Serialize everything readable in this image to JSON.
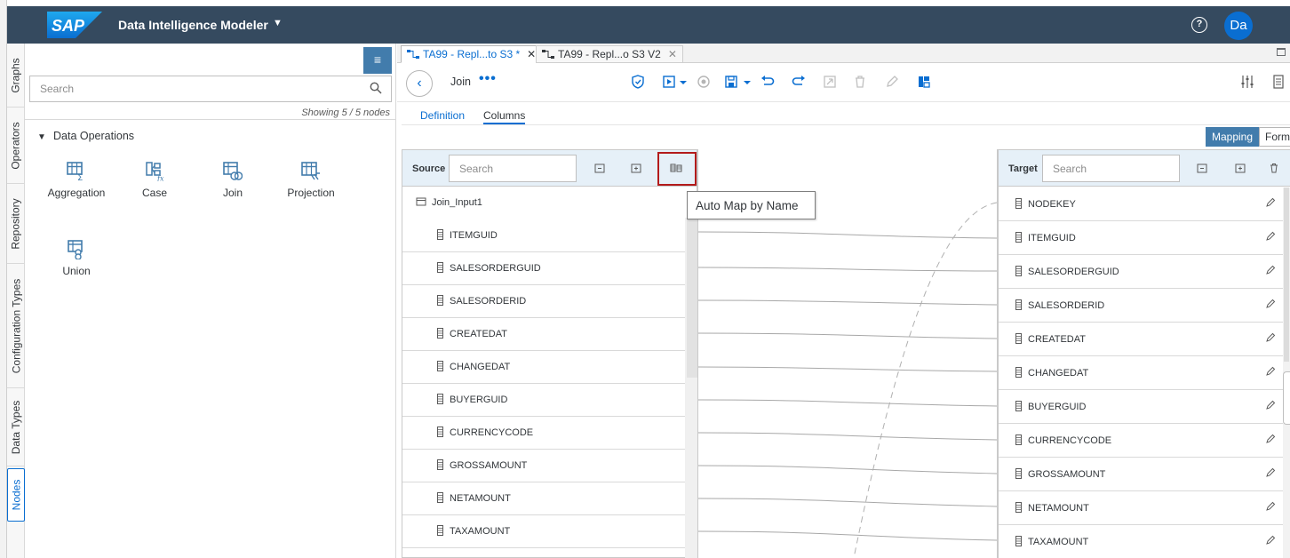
{
  "shell": {
    "logo_text": "SAP",
    "app_title": "Data Intelligence Modeler",
    "help_glyph": "?",
    "avatar_initials": "Da"
  },
  "vertical_tabs": [
    {
      "label": "Graphs"
    },
    {
      "label": "Operators"
    },
    {
      "label": "Repository"
    },
    {
      "label": "Configuration Types"
    },
    {
      "label": "Data Types"
    },
    {
      "label": "Nodes",
      "active": true
    }
  ],
  "left_panel": {
    "search_placeholder": "Search",
    "showing_text": "Showing 5 / 5 nodes",
    "group_title": "Data Operations",
    "operators": [
      {
        "label": "Aggregation",
        "icon": "aggregation-icon"
      },
      {
        "label": "Case",
        "icon": "case-icon"
      },
      {
        "label": "Join",
        "icon": "join-icon"
      },
      {
        "label": "Projection",
        "icon": "projection-icon"
      },
      {
        "label": "Union",
        "icon": "union-icon"
      }
    ]
  },
  "editor_tabs": [
    {
      "label": "TA99 - Repl...to S3 *",
      "active": true
    },
    {
      "label": "TA99 - Repl...o S3 V2",
      "active": false
    }
  ],
  "toolbar": {
    "title": "Join",
    "more": "•••"
  },
  "sub_tabs": [
    {
      "label": "Definition",
      "selected": false
    },
    {
      "label": "Columns",
      "selected": true
    }
  ],
  "view_toggle": {
    "mapping": "Mapping",
    "form": "Form",
    "selected": "Mapping"
  },
  "source": {
    "label": "Source",
    "search_placeholder": "Search",
    "root": "Join_Input1",
    "columns": [
      "ITEMGUID",
      "SALESORDERGUID",
      "SALESORDERID",
      "CREATEDAT",
      "CHANGEDAT",
      "BUYERGUID",
      "CURRENCYCODE",
      "GROSSAMOUNT",
      "NETAMOUNT",
      "TAXAMOUNT"
    ]
  },
  "tooltip": {
    "text": "Auto Map by Name"
  },
  "target": {
    "label": "Target",
    "search_placeholder": "Search",
    "columns": [
      "NODEKEY",
      "ITEMGUID",
      "SALESORDERGUID",
      "SALESORDERID",
      "CREATEDAT",
      "CHANGEDAT",
      "BUYERGUID",
      "CURRENCYCODE",
      "GROSSAMOUNT",
      "NETAMOUNT",
      "TAXAMOUNT"
    ]
  },
  "colors": {
    "shell_bg": "#354a5f",
    "accent": "#0a6ed1",
    "button_blue": "#427cac",
    "panel_header": "#e6f0f8",
    "highlight_red": "#b31b1b"
  }
}
